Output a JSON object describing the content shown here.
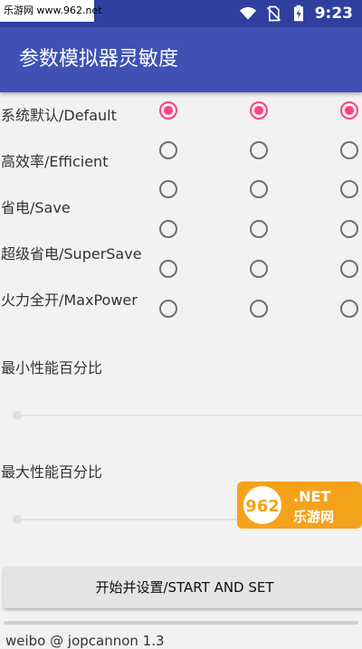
{
  "status": {
    "watermark": "乐游网 www.962.net",
    "time": "9:23"
  },
  "app": {
    "title": "参数模拟器灵敏度"
  },
  "modes": [
    {
      "label": "系统默认/Default",
      "selected": [
        true,
        true,
        true
      ]
    },
    {
      "label": "高效率/Efficient",
      "selected": [
        false,
        false,
        false
      ]
    },
    {
      "label": "省电/Save",
      "selected": [
        false,
        false,
        false
      ]
    },
    {
      "label": "超级省电/SuperSave",
      "selected": [
        false,
        false,
        false
      ]
    },
    {
      "label": "火力全开/MaxPower",
      "selected": [
        false,
        false,
        false
      ]
    }
  ],
  "extra_radio_row": {
    "selected": [
      false,
      false,
      false
    ]
  },
  "sliders": {
    "min_label": "最小性能百分比",
    "max_label": "最大性能百分比",
    "min_value": 0,
    "max_value": 0
  },
  "button": {
    "label": "开始并设置/START AND SET"
  },
  "footer": {
    "text": "weibo @ jopcannon 1.3"
  },
  "badge": {
    "main": "962",
    "suffix": ".NET",
    "caption": "乐游网"
  },
  "colors": {
    "statusbar": "#303f9f",
    "appbar": "#3f51b5",
    "accent": "#ff4081"
  }
}
